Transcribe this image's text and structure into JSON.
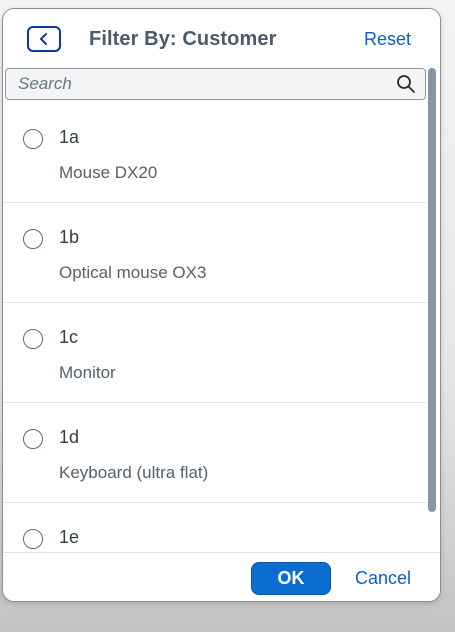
{
  "header": {
    "title": "Filter By: Customer",
    "reset_label": "Reset",
    "back_icon": "chevron-left-icon"
  },
  "search": {
    "placeholder": "Search",
    "value": "",
    "icon": "search-icon"
  },
  "items": [
    {
      "key": "1a",
      "description": "Mouse DX20",
      "selected": false
    },
    {
      "key": "1b",
      "description": "Optical mouse OX3",
      "selected": false
    },
    {
      "key": "1c",
      "description": "Monitor",
      "selected": false
    },
    {
      "key": "1d",
      "description": "Keyboard (ultra flat)",
      "selected": false
    },
    {
      "key": "1e",
      "description": "",
      "selected": false
    }
  ],
  "footer": {
    "ok_label": "OK",
    "cancel_label": "Cancel"
  },
  "colors": {
    "accent": "#0a6ed1",
    "link": "#0a5fd0",
    "title": "#4a5b6e",
    "scrollbar": "#8595a6"
  }
}
